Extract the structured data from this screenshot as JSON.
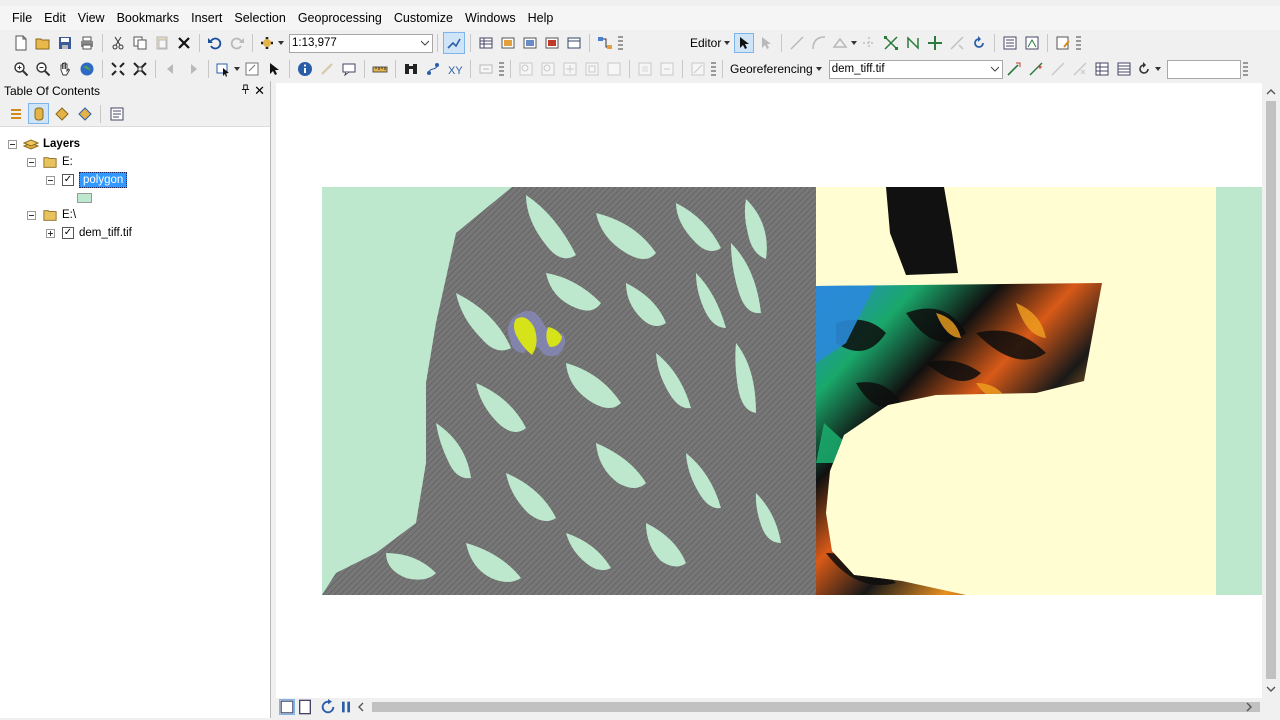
{
  "menu": [
    "File",
    "Edit",
    "View",
    "Bookmarks",
    "Insert",
    "Selection",
    "Geoprocessing",
    "Customize",
    "Windows",
    "Help"
  ],
  "standard_toolbar": {
    "scale_value": "1:13,977",
    "editor_label": "Editor"
  },
  "tools_toolbar": {
    "georeferencing_label": "Georeferencing",
    "layer_combo_value": "dem_tiff.tif"
  },
  "toc": {
    "title": "Table Of Contents",
    "pin_glyph": "ᴾ",
    "close_glyph": "✕",
    "root_label": "Layers",
    "groups": [
      {
        "label": "E:",
        "layer": "polygon",
        "legend_color": "#bde8cd"
      },
      {
        "label": "E:\\",
        "layer": "dem_tiff.tif"
      }
    ]
  },
  "colors": {
    "polygon_fill": "#bde8cd",
    "polygon_lines": "#757575",
    "nodata_fill": "#fffdd1",
    "selection_highlight": "#d6e31a",
    "selected_label_bg": "#3399ff"
  }
}
